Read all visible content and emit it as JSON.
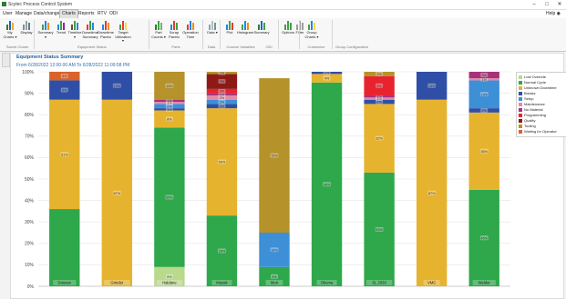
{
  "window": {
    "title": "Scytec Process Control System",
    "minimize": "–",
    "maximize": "□",
    "close": "✕"
  },
  "menu": {
    "items": [
      "User",
      "Manage",
      "Data/change",
      "Charts",
      "Reports",
      "RTV",
      "ODI"
    ],
    "active": "Charts",
    "help": "Help ◉"
  },
  "ribbon": {
    "buttons": [
      {
        "label": "My Charts ▾",
        "icon": "charts-icon"
      },
      {
        "label": "Display",
        "icon": "display-icon"
      },
      {
        "label": "Summary ▾",
        "icon": "summary-icon"
      },
      {
        "label": "Trend",
        "icon": "trend-icon"
      },
      {
        "label": "Timeline ▾",
        "icon": "timeline-icon"
      },
      {
        "label": "Downtime Summary",
        "icon": "downtime-summary-icon"
      },
      {
        "label": "Downtime Pareto",
        "icon": "downtime-pareto-icon"
      },
      {
        "label": "Target Utilization ▾",
        "icon": "target-utilization-icon"
      },
      {
        "label": "Part Counts ▾",
        "icon": "part-counts-icon"
      },
      {
        "label": "Scrap Pareto",
        "icon": "scrap-pareto-icon"
      },
      {
        "label": "Operation Time",
        "icon": "operation-time-icon"
      },
      {
        "label": "Data ▾",
        "icon": "data-icon"
      },
      {
        "label": "Plot",
        "icon": "plot-icon"
      },
      {
        "label": "Histogram",
        "icon": "histogram-icon"
      },
      {
        "label": "Summary",
        "icon": "spc-summary-icon"
      },
      {
        "label": "Options",
        "icon": "checkmark-icon"
      },
      {
        "label": "Filter",
        "icon": "filter-icon"
      },
      {
        "label": "Group Charts ▾",
        "icon": "group-charts-icon"
      }
    ],
    "groups": [
      "Saved Charts",
      "Equipment Status",
      "Parts",
      "Data",
      "Custom Variables",
      "ODI",
      "Customize",
      "Group Configuration"
    ]
  },
  "report": {
    "title": "Equipment Status Summary",
    "subtitle": "From 6/28/2022 12:00:00 AM To 6/28/2022 11:09:58 PM"
  },
  "colors": {
    "accent": "#1f5e9c"
  },
  "chart_data": {
    "type": "bar",
    "stacked": true,
    "ylim": [
      0,
      100
    ],
    "ytick_labels": [
      "0%",
      "10%",
      "20%",
      "30%",
      "40%",
      "50%",
      "60%",
      "70%",
      "80%",
      "90%",
      "100%"
    ],
    "grid": true,
    "legend_position": "right",
    "categories": [
      "Doosan",
      "Grinder",
      "Haldane",
      "Mazak",
      "Mori",
      "Okuma",
      "SL 2030",
      "VMC",
      "Welder"
    ],
    "series": [
      {
        "name": "Lost Override",
        "color": "#b9d98b",
        "values": [
          0,
          0,
          9,
          0,
          0,
          0,
          0,
          0,
          0
        ]
      },
      {
        "name": "Normal Cycle",
        "color": "#2ea84a",
        "values": [
          36,
          0,
          65,
          33,
          9,
          95,
          53,
          0,
          45
        ]
      },
      {
        "name": "Unknown Downtime",
        "color": "#e6b32e",
        "values": [
          51,
          87,
          8,
          50,
          0,
          4,
          32,
          87,
          36
        ]
      },
      {
        "name": "Breaks",
        "color": "#2f4fa6",
        "values": [
          9,
          13,
          1,
          2,
          0,
          1,
          2,
          13,
          2
        ]
      },
      {
        "name": "Setup",
        "color": "#3d8fd6",
        "values": [
          0,
          0,
          2,
          2,
          16,
          0,
          0,
          0,
          13
        ]
      },
      {
        "name": "Maintenance",
        "color": "#e38aa8",
        "values": [
          0,
          0,
          1,
          2,
          0,
          0,
          1,
          0,
          1
        ]
      },
      {
        "name": "No Material",
        "color": "#a8327a",
        "values": [
          0,
          0,
          1,
          1,
          0,
          0,
          1,
          0,
          3
        ]
      },
      {
        "name": "Programming",
        "color": "#e8232e",
        "values": [
          0,
          0,
          0,
          2,
          0,
          0,
          9,
          0,
          0
        ]
      },
      {
        "name": "Quality",
        "color": "#8e1a18",
        "values": [
          0,
          0,
          0,
          7,
          0,
          0,
          0,
          0,
          0
        ]
      },
      {
        "name": "Tooling",
        "color": "#b5922a",
        "values": [
          0,
          0,
          13,
          1,
          72,
          0,
          2,
          0,
          0
        ]
      },
      {
        "name": "Waiting for Operator",
        "color": "#d9632a",
        "values": [
          4,
          0,
          0,
          0,
          0,
          0,
          0,
          0,
          0
        ]
      }
    ],
    "segment_labels": [
      [
        "36%",
        "",
        "51%",
        "9%",
        "",
        "",
        "",
        "",
        "",
        "",
        "4%"
      ],
      [
        "",
        "",
        "87%",
        "13%",
        "",
        "",
        "",
        "",
        "",
        "",
        ""
      ],
      [
        "9%",
        "65%",
        "8%",
        "1%",
        "2%",
        "1%",
        "1%",
        "",
        "",
        "13%",
        ""
      ],
      [
        "",
        "33%",
        "50%",
        "2%",
        "2%",
        "2%",
        "1%",
        "2%",
        "7%",
        "1%",
        ""
      ],
      [
        "",
        "9%",
        "",
        "",
        "16%",
        "",
        "",
        "",
        "",
        "72%",
        ""
      ],
      [
        "",
        "95%",
        "4%",
        "1%",
        "",
        "",
        "",
        "",
        "",
        "",
        ""
      ],
      [
        "",
        "53%",
        "32%",
        "2%",
        "",
        "1%",
        "1%",
        "9%",
        "",
        "2%",
        ""
      ],
      [
        "",
        "",
        "87%",
        "13%",
        "",
        "",
        "",
        "",
        "",
        "",
        ""
      ],
      [
        "",
        "45%",
        "36%",
        "2%",
        "13%",
        "1%",
        "3%",
        "",
        "",
        "",
        ""
      ]
    ]
  }
}
